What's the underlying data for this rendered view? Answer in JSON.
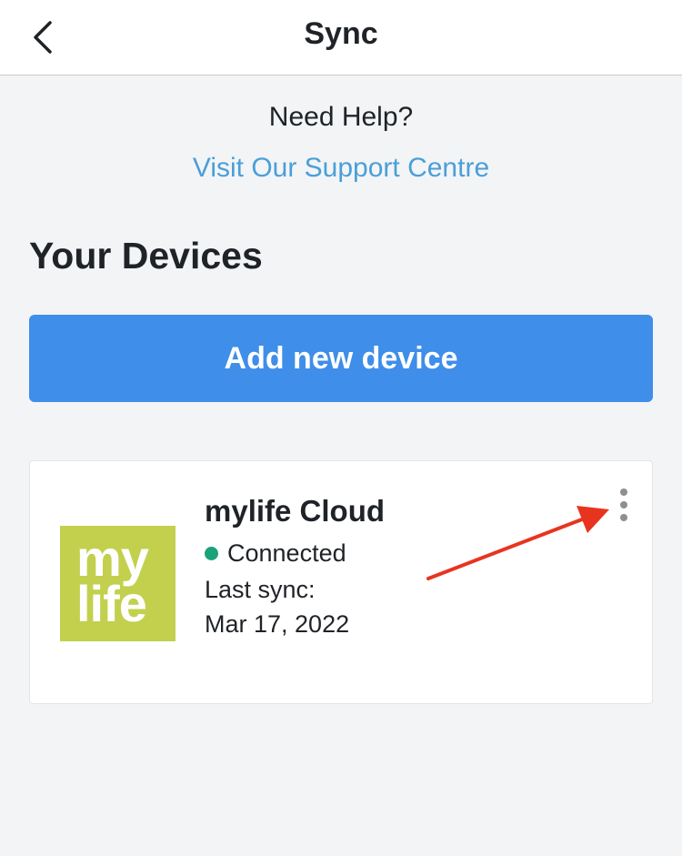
{
  "nav": {
    "title": "Sync",
    "back_icon": "chevron-left-icon"
  },
  "help": {
    "prompt": "Need Help?",
    "support_link": "Visit Our Support Centre"
  },
  "devices_section": {
    "heading": "Your Devices",
    "add_button_label": "Add new device"
  },
  "device": {
    "name": "mylife Cloud",
    "status": "Connected",
    "last_sync_label": "Last sync:",
    "last_sync_date": "Mar 17, 2022",
    "logo_text_line1": "my",
    "logo_text_line2": "life",
    "more_icon": "more-vertical-icon"
  },
  "colors": {
    "accent_blue": "#3f8ee9",
    "link_blue": "#4a9fd8",
    "status_green": "#1aa37a",
    "logo_green": "#c2d04e",
    "annotation_red": "#e8341f"
  }
}
